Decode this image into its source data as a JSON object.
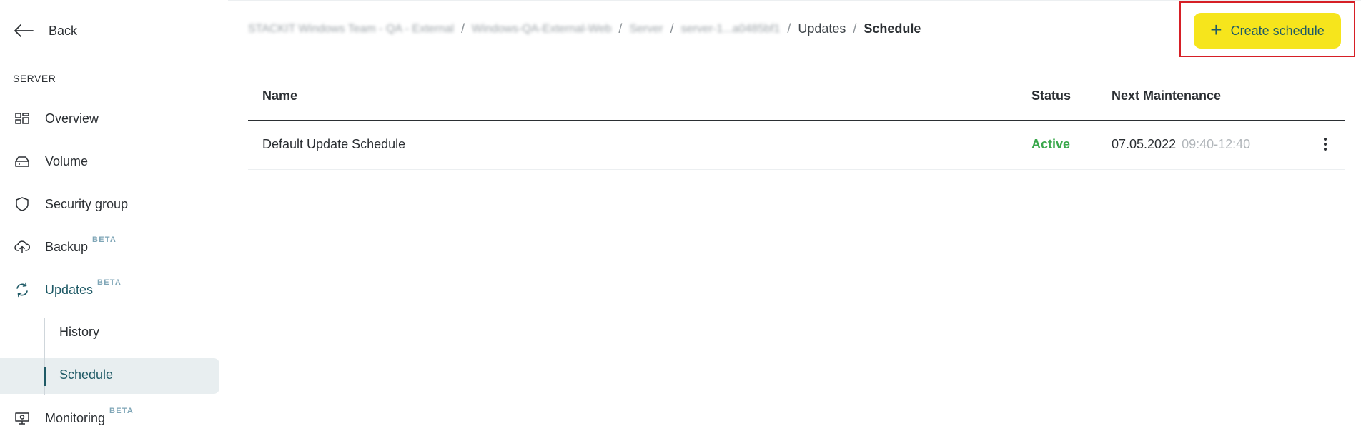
{
  "sidebar": {
    "back_label": "Back",
    "section_label": "SERVER",
    "items": [
      {
        "label": "Overview",
        "icon": "grid-icon",
        "beta": ""
      },
      {
        "label": "Volume",
        "icon": "disk-icon",
        "beta": ""
      },
      {
        "label": "Security group",
        "icon": "shield-icon",
        "beta": ""
      },
      {
        "label": "Backup",
        "icon": "cloud-upload-icon",
        "beta": "BETA"
      },
      {
        "label": "Updates",
        "icon": "refresh-icon",
        "beta": "BETA"
      },
      {
        "label": "Monitoring",
        "icon": "monitor-icon",
        "beta": "BETA"
      }
    ],
    "sub_items": [
      {
        "label": "History"
      },
      {
        "label": "Schedule"
      }
    ]
  },
  "breadcrumb": {
    "blurred": [
      "STACKIT Windows Team - QA - External",
      "Windows-QA-External-Web",
      "Server",
      "server-1...a0485bf1"
    ],
    "items": [
      "Updates",
      "Schedule"
    ],
    "separator": "/"
  },
  "actions": {
    "create_label": "Create schedule",
    "create_icon": "plus-icon"
  },
  "table": {
    "columns": [
      "Name",
      "Status",
      "Next Maintenance"
    ],
    "rows": [
      {
        "name": "Default Update Schedule",
        "status": "Active",
        "date": "07.05.2022",
        "time": "09:40-12:40"
      }
    ]
  },
  "colors": {
    "accent": "#1f5a66",
    "button_bg": "#f6e51c",
    "active_status": "#3aa84c",
    "highlight_border": "#d61f26"
  }
}
